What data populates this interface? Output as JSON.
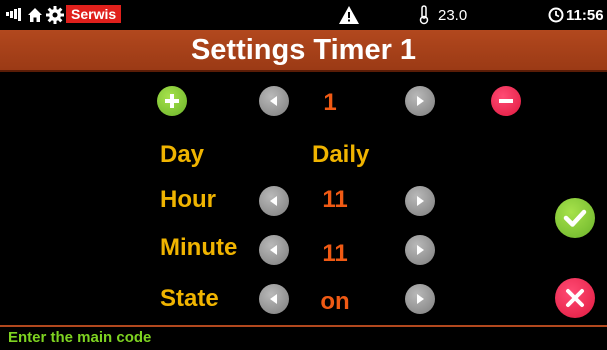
{
  "status_bar": {
    "mode_badge": "Serwis",
    "temperature": "23.0",
    "time": "11:56"
  },
  "title": "Settings Timer 1",
  "timer": {
    "number": "1",
    "rows": [
      {
        "label": "Day",
        "value": "Daily"
      },
      {
        "label": "Hour",
        "value": "11"
      },
      {
        "label": "Minute",
        "value": "11"
      },
      {
        "label": "State",
        "value": "on"
      }
    ]
  },
  "footer": {
    "message": "Enter the main code"
  },
  "colors": {
    "title_bar": "#b2481e",
    "label_text": "#f0b400",
    "value_text": "#f05a14",
    "footer_text": "#7ed321",
    "confirm_button": "#7ac943",
    "cancel_button": "#f0204f",
    "badge": "#e0201c"
  },
  "icons": [
    "signal-icon",
    "home-icon",
    "gear-icon",
    "warning-icon",
    "thermometer-icon",
    "clock-icon",
    "plus-icon",
    "minus-icon",
    "arrow-left-icon",
    "arrow-right-icon",
    "checkmark-icon",
    "close-icon"
  ]
}
